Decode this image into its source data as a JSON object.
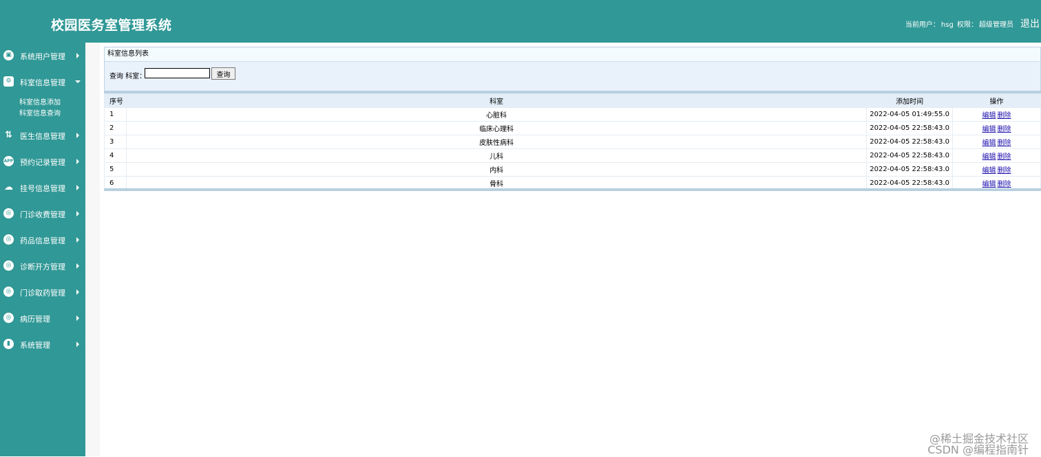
{
  "header": {
    "title": "校园医务室管理系统",
    "user_label": "当前用户：",
    "user_name": "hsg",
    "role_label": "权限：",
    "role_name": "超级管理员",
    "logout": "退出"
  },
  "sidebar": {
    "items": [
      {
        "label": "系统用户管理",
        "icon": "user-list-icon",
        "expanded": false
      },
      {
        "label": "科室信息管理",
        "icon": "user-gear-icon",
        "expanded": true,
        "children": [
          "科室信息添加",
          "科室信息查询"
        ]
      },
      {
        "label": "医生信息管理",
        "icon": "doctor-icon",
        "expanded": false
      },
      {
        "label": "预约记录管理",
        "icon": "app-icon",
        "expanded": false
      },
      {
        "label": "挂号信息管理",
        "icon": "cloud-icon",
        "expanded": false
      },
      {
        "label": "门诊收费管理",
        "icon": "target-icon",
        "expanded": false
      },
      {
        "label": "药品信息管理",
        "icon": "target-icon",
        "expanded": false
      },
      {
        "label": "诊断开方管理",
        "icon": "target-icon",
        "expanded": false
      },
      {
        "label": "门诊取药管理",
        "icon": "target-icon",
        "expanded": false
      },
      {
        "label": "病历管理",
        "icon": "target-icon",
        "expanded": false
      },
      {
        "label": "系统管理",
        "icon": "chart-icon",
        "expanded": false
      }
    ]
  },
  "panel": {
    "title": "科室信息列表",
    "search_label": "查询 科室：",
    "search_value": "",
    "search_button": "查询"
  },
  "table": {
    "columns": [
      "序号",
      "科室",
      "添加时间",
      "操作"
    ],
    "rows": [
      {
        "no": "1",
        "dept": "心脏科",
        "time": "2022-04-05 01:49:55.0"
      },
      {
        "no": "2",
        "dept": "临床心理科",
        "time": "2022-04-05 22:58:43.0"
      },
      {
        "no": "3",
        "dept": "皮肤性病科",
        "time": "2022-04-05 22:58:43.0"
      },
      {
        "no": "4",
        "dept": "儿科",
        "time": "2022-04-05 22:58:43.0"
      },
      {
        "no": "5",
        "dept": "内科",
        "time": "2022-04-05 22:58:43.0"
      },
      {
        "no": "6",
        "dept": "骨科",
        "time": "2022-04-05 22:58:43.0"
      }
    ],
    "edit_label": "编辑",
    "delete_label": "删除"
  },
  "watermark": {
    "line1": "@稀土掘金技术社区",
    "line2": "CSDN @编程指南针"
  },
  "colors": {
    "header_bg": "#309896",
    "sidebar_bg": "#309896",
    "panel_bg": "#e9f1fb",
    "link": "#1a0dab"
  }
}
